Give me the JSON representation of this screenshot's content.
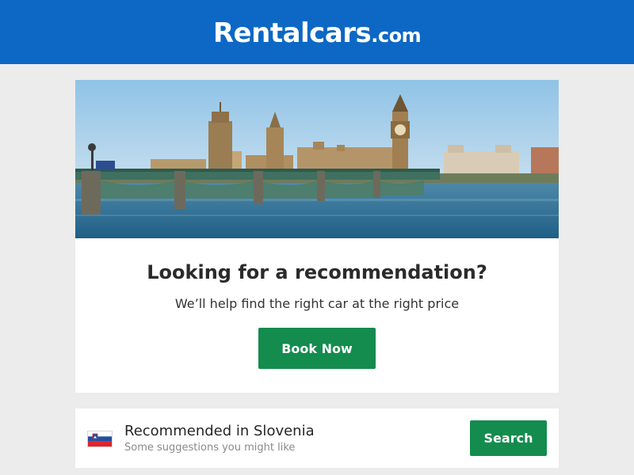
{
  "header": {
    "logo_brand": "Rentalcars",
    "logo_tld": ".com",
    "background": "#0c68c4"
  },
  "hero": {
    "image_icon": "london-westminster-photo",
    "title": "Looking for a recommendation?",
    "subtitle": "We’ll help find the right car at the right price",
    "cta_label": "Book Now"
  },
  "recommendation": {
    "flag_icon": "slovenia-flag-icon",
    "title": "Recommended in Slovenia",
    "subtitle": "Some suggestions you might like",
    "button_label": "Search"
  },
  "colors": {
    "accent_green": "#138c4e",
    "page_background": "#ececec"
  }
}
